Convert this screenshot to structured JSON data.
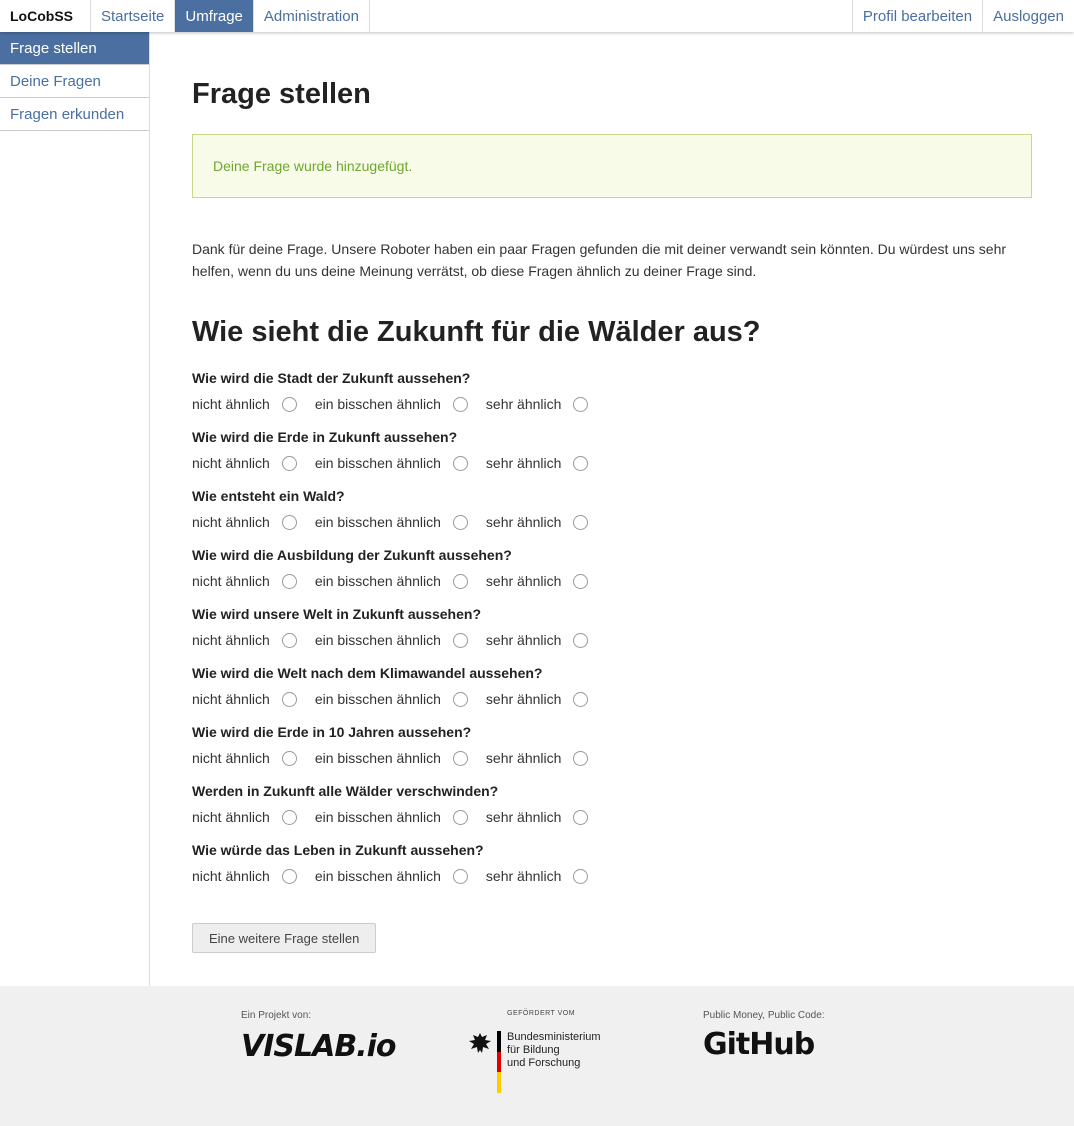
{
  "nav": {
    "brand": "LoCobSS",
    "links": [
      "Startseite",
      "Umfrage",
      "Administration"
    ],
    "right_links": [
      "Profil bearbeiten",
      "Ausloggen"
    ]
  },
  "sidebar": {
    "items": [
      "Frage stellen",
      "Deine Fragen",
      "Fragen erkunden"
    ]
  },
  "main": {
    "page_title": "Frage stellen",
    "alert": "Deine Frage wurde hinzugefügt.",
    "intro": "Dank für deine Frage. Unsere Roboter haben ein paar Fragen gefunden die mit deiner verwandt sein könnten. Du würdest uns sehr helfen, wenn du uns deine Meinung verrätst, ob diese Fragen ähnlich zu deiner Frage sind.",
    "question": "Wie sieht die Zukunft für die Wälder aus?",
    "rating_labels": [
      "nicht ähnlich",
      "ein bisschen ähnlich",
      "sehr ähnlich"
    ],
    "related": [
      "Wie wird die Stadt der Zukunft aussehen?",
      "Wie wird die Erde in Zukunft aussehen?",
      "Wie entsteht ein Wald?",
      "Wie wird die Ausbildung der Zukunft aussehen?",
      "Wie wird unsere Welt in Zukunft aussehen?",
      "Wie wird die Welt nach dem Klimawandel aussehen?",
      "Wie wird die Erde in 10 Jahren aussehen?",
      "Werden in Zukunft alle Wälder verschwinden?",
      "Wie würde das Leben in Zukunft aussehen?"
    ],
    "button": "Eine weitere Frage stellen"
  },
  "footer": {
    "project_label": "Ein Projekt von:",
    "vislab_logo": "VISLAB.io",
    "funded_label": "GEFÖRDERT VOM",
    "bmbf_line1": "Bundesministerium",
    "bmbf_line2": "für Bildung",
    "bmbf_line3": "und Forschung",
    "code_label": "Public Money, Public Code:",
    "github_logo": "GitHub"
  },
  "colors": {
    "accent": "#4a6fa0",
    "success_text": "#6ea82f",
    "success_border": "#c7d98a"
  }
}
